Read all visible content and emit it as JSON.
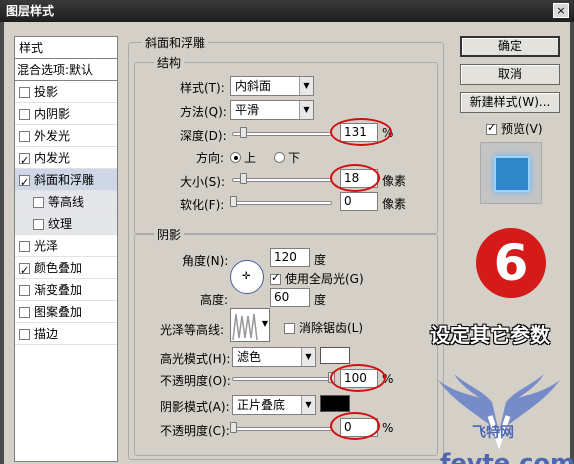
{
  "window": {
    "title": "图层样式",
    "close": "×"
  },
  "sidebar": {
    "header": "样式",
    "blend": "混合选项:默认",
    "items": [
      {
        "label": "投影",
        "checked": false
      },
      {
        "label": "内阴影",
        "checked": false
      },
      {
        "label": "外发光",
        "checked": false
      },
      {
        "label": "内发光",
        "checked": true
      },
      {
        "label": "斜面和浮雕",
        "checked": true
      },
      {
        "label": "等高线",
        "checked": false
      },
      {
        "label": "纹理",
        "checked": false
      },
      {
        "label": "光泽",
        "checked": false
      },
      {
        "label": "颜色叠加",
        "checked": true
      },
      {
        "label": "渐变叠加",
        "checked": false
      },
      {
        "label": "图案叠加",
        "checked": false
      },
      {
        "label": "描边",
        "checked": false
      }
    ]
  },
  "bevel": {
    "title": "斜面和浮雕",
    "structure": {
      "title": "结构",
      "style_label": "样式(T):",
      "style_value": "内斜面",
      "technique_label": "方法(Q):",
      "technique_value": "平滑",
      "depth_label": "深度(D):",
      "depth_value": "131",
      "depth_unit": "%",
      "direction_label": "方向:",
      "dir_up": "上",
      "dir_down": "下",
      "size_label": "大小(S):",
      "size_value": "18",
      "size_unit": "像素",
      "soften_label": "软化(F):",
      "soften_value": "0",
      "soften_unit": "像素"
    },
    "shading": {
      "title": "阴影",
      "angle_label": "角度(N):",
      "angle_value": "120",
      "angle_unit": "度",
      "global_light": "使用全局光(G)",
      "altitude_label": "高度:",
      "altitude_value": "60",
      "altitude_unit": "度",
      "gloss_label": "光泽等高线:",
      "antialias": "消除锯齿(L)",
      "highlight_label": "高光模式(H):",
      "highlight_value": "滤色",
      "highlight_color": "#ffffff",
      "hl_opacity_label": "不透明度(O):",
      "hl_opacity_value": "100",
      "hl_opacity_unit": "%",
      "shadow_label": "阴影模式(A):",
      "shadow_value": "正片叠底",
      "shadow_color": "#000000",
      "sh_opacity_label": "不透明度(C):",
      "sh_opacity_value": "0",
      "sh_opacity_unit": "%"
    }
  },
  "buttons": {
    "ok": "确定",
    "cancel": "取消",
    "new_style": "新建样式(W)...",
    "preview": "预览(V)"
  },
  "annotation": {
    "step": "6",
    "caption": "设定其它参数"
  },
  "watermark": {
    "cn": "飞特网",
    "en": "fevte.com"
  }
}
